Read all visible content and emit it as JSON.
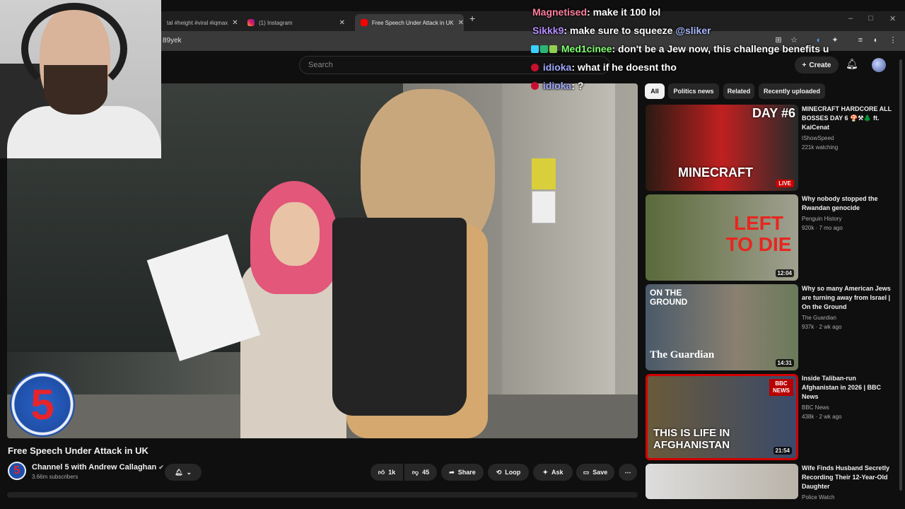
{
  "browser": {
    "tabs": [
      {
        "label": "tal #height #viral #iqmax",
        "active": false
      },
      {
        "label": "(1) Instagram",
        "active": false
      },
      {
        "label": "Free Speech Under Attack in UK",
        "active": true
      }
    ],
    "new_tab": "+",
    "address_fragment": "89yek",
    "window_controls": [
      "–",
      "□",
      "✕"
    ]
  },
  "youtube": {
    "search_placeholder": "Search",
    "create_label": "Create",
    "logo_badge": "5",
    "video": {
      "title": "Free Speech Under Attack in UK",
      "channel": "Channel 5 with Andrew Callaghan",
      "subscribers": "3.66m subscribers",
      "likes": "1k",
      "dislikes": "45",
      "share": "Share",
      "loop": "Loop",
      "ask": "Ask",
      "save": "Save",
      "more": "⋯"
    },
    "chips": [
      "All",
      "Politics news",
      "Related",
      "Recently uploaded"
    ],
    "recommendations": [
      {
        "title": "MINECRAFT HARDCORE ALL BOSSES DAY 6 🍄⚒🌲 ft. KaiCenat",
        "channel": "IShowSpeed",
        "meta": "221k watching",
        "badge": "LIVE",
        "thumb_text": "DAY #6",
        "thumb_sub": "MINECRAFT"
      },
      {
        "title": "Why nobody stopped the Rwandan genocide",
        "channel": "Penguin History",
        "meta": "920k · 7 mo ago",
        "badge": "12:04",
        "thumb_text": "LEFT TO DIE"
      },
      {
        "title": "Why so many American Jews are turning away from Israel | On the Ground",
        "channel": "The Guardian",
        "meta": "937k · 2 wk ago",
        "badge": "14:31",
        "thumb_text": "ON THE GROUND",
        "thumb_sub": "The Guardian"
      },
      {
        "title": "Inside Taliban-run Afghanistan in 2026 | BBC News",
        "channel": "BBC News",
        "meta": "438k · 2 wk ago",
        "badge": "21:54",
        "thumb_text": "THIS IS LIFE IN AFGHANISTAN",
        "thumb_sub": "BBC NEWS"
      },
      {
        "title": "Wife Finds Husband Secretly Recording Their 12-Year-Old Daughter",
        "channel": "Police Watch",
        "meta": "",
        "badge": "",
        "thumb_text": ""
      }
    ]
  },
  "chat": [
    {
      "user": "Magnetised",
      "message": ": make it 100 lol",
      "color": "#ff7f9e"
    },
    {
      "user": "Sikkk9",
      "message": ": make sure to squeeze ",
      "mention": "@sliker",
      "color": "#b58cff"
    },
    {
      "user": "Med1cinee",
      "message": ": don't be a Jew now, this challenge benefits u",
      "color": "#7dff6e"
    },
    {
      "user": "idioka",
      "message": ": what if he doesnt tho",
      "color": "#9fa8ff"
    },
    {
      "user": "idioka",
      "message": ": ?",
      "color": "#9fa8ff"
    }
  ],
  "colors": {
    "background": "#0f0f0f",
    "pill": "#272727",
    "accent_red": "#cc0000"
  }
}
